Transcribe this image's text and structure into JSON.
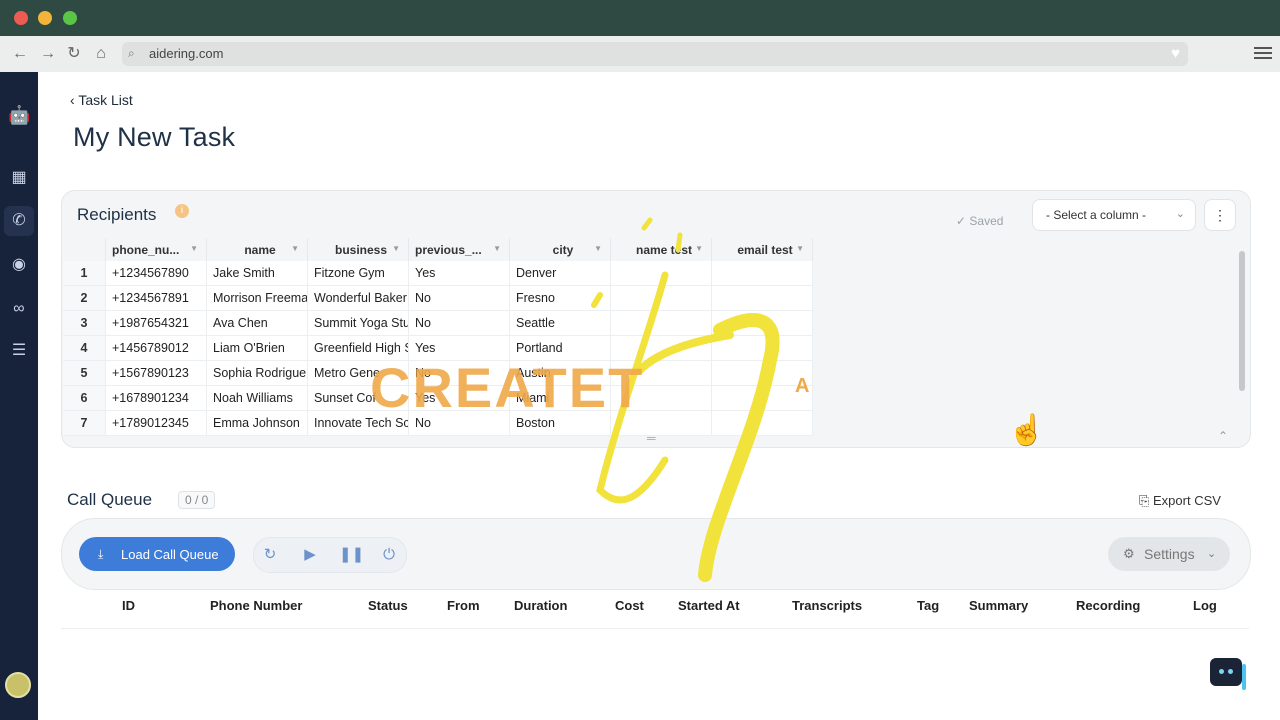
{
  "browser": {
    "url": "aidering.com"
  },
  "nav": {
    "back_label": "Task List"
  },
  "page": {
    "title": "My New Task"
  },
  "recipients": {
    "title": "Recipients",
    "saved_label": "✓ Saved",
    "select_placeholder": "- Select a column -",
    "columns": [
      "phone_nu...",
      "name",
      "business",
      "previous_...",
      "city",
      "name test",
      "email test"
    ],
    "rows": [
      {
        "n": "1",
        "phone": "+1234567890",
        "name": "Jake Smith",
        "business": "Fitzone Gym",
        "previous": "Yes",
        "city": "Denver"
      },
      {
        "n": "2",
        "phone": "+1234567891",
        "name": "Morrison Freema",
        "business": "Wonderful Baker",
        "previous": "No",
        "city": "Fresno"
      },
      {
        "n": "3",
        "phone": "+1987654321",
        "name": "Ava Chen",
        "business": "Summit Yoga Stu",
        "previous": "No",
        "city": "Seattle"
      },
      {
        "n": "4",
        "phone": "+1456789012",
        "name": "Liam O'Brien",
        "business": "Greenfield High S",
        "previous": "Yes",
        "city": "Portland"
      },
      {
        "n": "5",
        "phone": "+1567890123",
        "name": "Sophia Rodrigue:",
        "business": "Metro Gene",
        "previous": "No",
        "city": "Austin"
      },
      {
        "n": "6",
        "phone": "+1678901234",
        "name": "Noah Williams",
        "business": "Sunset Cof",
        "previous": "Yes",
        "city": "Miami"
      },
      {
        "n": "7",
        "phone": "+1789012345",
        "name": "Emma Johnson",
        "business": "Innovate Tech Sc",
        "previous": "No",
        "city": "Boston"
      }
    ]
  },
  "call_queue": {
    "title": "Call Queue",
    "count": "0 / 0",
    "export_label": "Export CSV",
    "load_label": "Load Call Queue",
    "settings_label": "Settings",
    "columns": [
      "ID",
      "Phone Number",
      "Status",
      "From",
      "Duration",
      "Cost",
      "Started At",
      "Transcripts",
      "Tag",
      "Summary",
      "Recording",
      "Log"
    ]
  },
  "overlay": {
    "watermark_text": "CREATET",
    "watermark_a": "A"
  },
  "colors": {
    "accent": "#3d7cd8",
    "sidebar": "#17233b",
    "watermark": "#f0a94a",
    "brush": "#f2e23c"
  }
}
